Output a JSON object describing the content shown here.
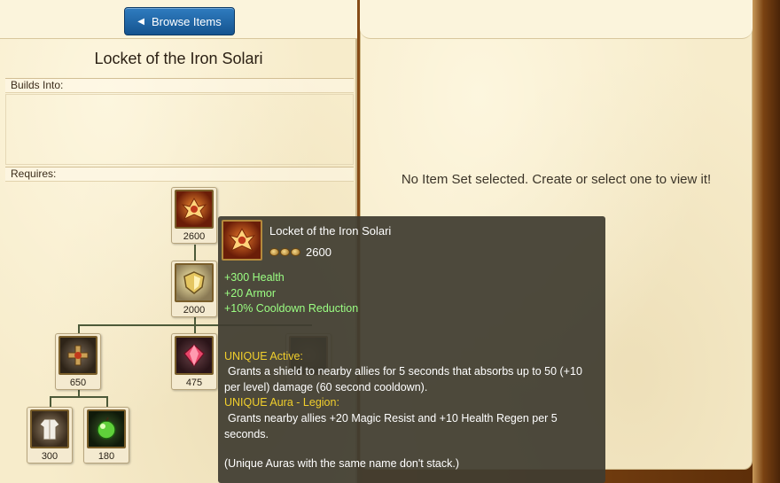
{
  "left": {
    "browse_button": "Browse Items",
    "item_title": "Locket of the Iron Solari",
    "builds_into_label": "Builds Into:",
    "requires_label": "Requires:",
    "tree": {
      "root": {
        "price": "2600",
        "icon": "locket-icon"
      },
      "mid": {
        "price": "2000",
        "icon": "shield-icon"
      },
      "children": [
        {
          "price": "650",
          "icon": "cross-amulet-icon"
        },
        {
          "price": "475",
          "icon": "ruby-crystal-icon"
        }
      ],
      "grandchildren": [
        {
          "price": "300",
          "icon": "cloth-armor-icon"
        },
        {
          "price": "180",
          "icon": "rejuvenation-bead-icon"
        }
      ]
    }
  },
  "right": {
    "empty_message": "No Item Set selected. Create or select one to view it!"
  },
  "tooltip": {
    "name": "Locket of the Iron Solari",
    "cost": "2600",
    "stats": [
      "+300 Health",
      "+20 Armor",
      "+10% Cooldown Reduction"
    ],
    "active_label": "UNIQUE Active:",
    "active_text": "Grants a shield to nearby allies for 5 seconds that absorbs up to 50 (+10 per level) damage (60 second cooldown).",
    "aura_label": "UNIQUE Aura - Legion:",
    "aura_text": "Grants nearby allies +20 Magic Resist and +10 Health Regen per 5 seconds.",
    "footnote": "(Unique Auras with the same name don't stack.)"
  },
  "colors": {
    "stat_green": "#9bff83",
    "unique_gold": "#f1cf2c",
    "button_blue": "#1f66a8"
  }
}
